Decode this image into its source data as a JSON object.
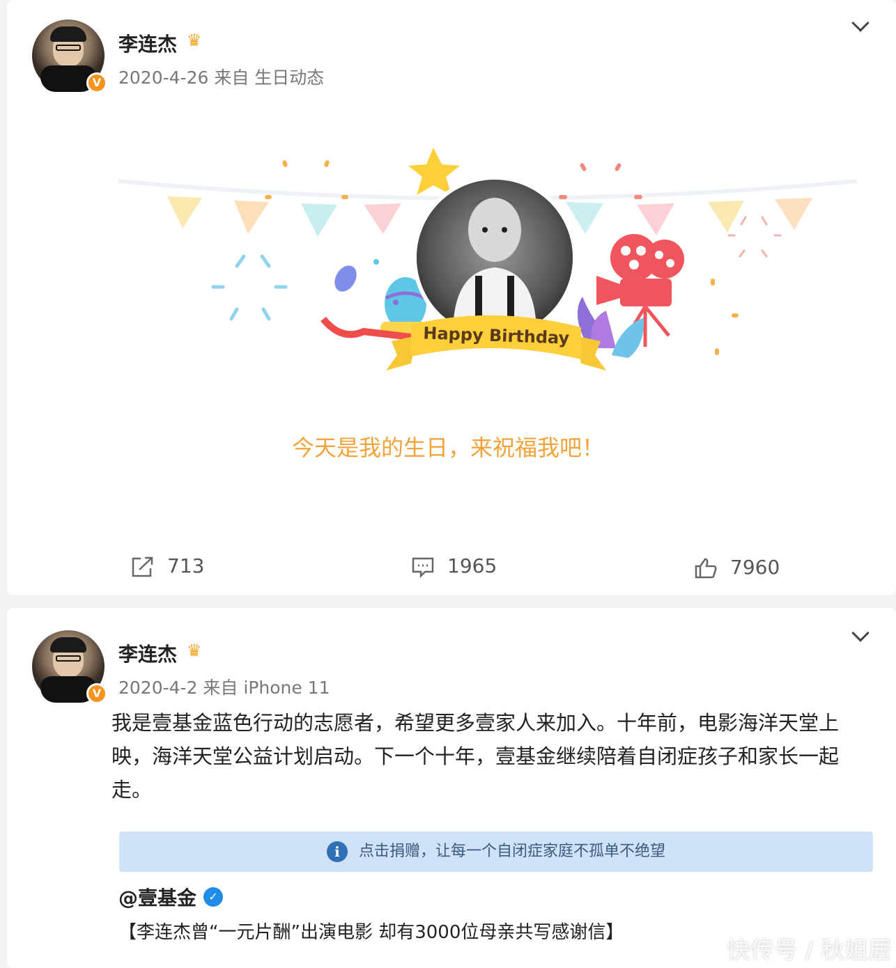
{
  "post1": {
    "author": "李连杰",
    "crown": "♛",
    "verified": "V",
    "meta": "2020-4-26 来自 生日动态",
    "banner_text": "Happy Birthday",
    "birthday_message": "今天是我的生日，来祝福我吧！",
    "actions": {
      "share_count": "713",
      "comment_count": "1965",
      "like_count": "7960"
    }
  },
  "post2": {
    "author": "李连杰",
    "crown": "♛",
    "verified": "V",
    "meta": "2020-4-2 来自 iPhone 11",
    "body": "我是壹基金蓝色行动的志愿者，希望更多壹家人来加入。十年前，电影海洋天堂上映，海洋天堂公益计划启动。下一个十年，壹基金继续陪着自闭症孩子和家长一起走。",
    "donate_icon": "i",
    "donate_text": "点击捐赠，让每一个自闭症家庭不孤单不绝望",
    "ref_account": "@壹基金",
    "ref_verified": "✓",
    "ref_title": "【李连杰曾“一元片酬”出演电影 却有3000位母亲共写感谢信】"
  },
  "watermark": "快传号 / 秋姐居",
  "colors": {
    "accent_orange": "#f7931e",
    "birthday_text": "#f3a33b",
    "donate_bg": "#cfe2f7",
    "weibo_blue": "#1f8ce8"
  }
}
